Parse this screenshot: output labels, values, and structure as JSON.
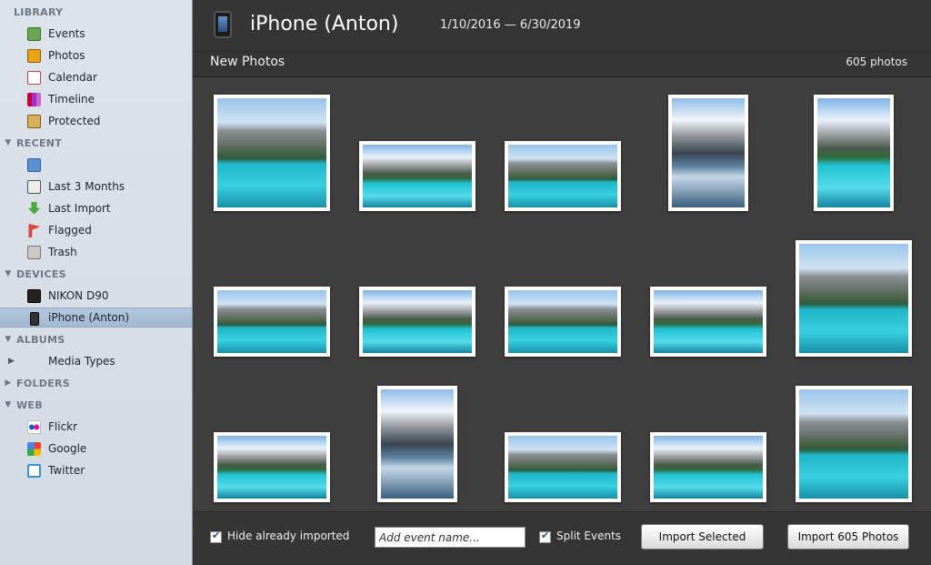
{
  "sidebar": {
    "sections": [
      {
        "title": "LIBRARY",
        "items": [
          {
            "label": "Events",
            "icon": "events-icon"
          },
          {
            "label": "Photos",
            "icon": "photos-icon"
          },
          {
            "label": "Calendar",
            "icon": "calendar-icon"
          },
          {
            "label": "Timeline",
            "icon": "timeline-icon"
          },
          {
            "label": "Protected",
            "icon": "protected-icon"
          }
        ]
      },
      {
        "title": "RECENT",
        "items": [
          {
            "label": "",
            "icon": "edit-icon"
          },
          {
            "label": "Last 3 Months",
            "icon": "clock-icon"
          },
          {
            "label": "Last Import",
            "icon": "import-icon"
          },
          {
            "label": "Flagged",
            "icon": "flag-icon"
          },
          {
            "label": "Trash",
            "icon": "trash-icon"
          }
        ]
      },
      {
        "title": "DEVICES",
        "items": [
          {
            "label": "NIKON D90",
            "icon": "camera-icon"
          },
          {
            "label": "iPhone (Anton)",
            "icon": "iphone-icon",
            "selected": true
          }
        ]
      },
      {
        "title": "ALBUMS",
        "items": [
          {
            "label": "Media Types",
            "icon": "disclosure-icon"
          }
        ]
      },
      {
        "title": "FOLDERS",
        "items": []
      },
      {
        "title": "WEB",
        "items": [
          {
            "label": "Flickr",
            "icon": "flickr-icon"
          },
          {
            "label": "Google",
            "icon": "google-icon"
          },
          {
            "label": "Twitter",
            "icon": "twitter-icon"
          }
        ]
      }
    ]
  },
  "header": {
    "device_title": "iPhone (Anton)",
    "date_range": "1/10/2016 — 6/30/2019"
  },
  "subbar": {
    "label": "New Photos",
    "count": "605 photos"
  },
  "photos": {
    "total_visible": 15
  },
  "bottom": {
    "hide_imported_label": "Hide already imported",
    "hide_imported_checked": true,
    "event_placeholder": "Add event name...",
    "split_events_label": "Split Events",
    "split_events_checked": true,
    "import_selected_label": "Import Selected",
    "import_all_label": "Import 605 Photos"
  }
}
